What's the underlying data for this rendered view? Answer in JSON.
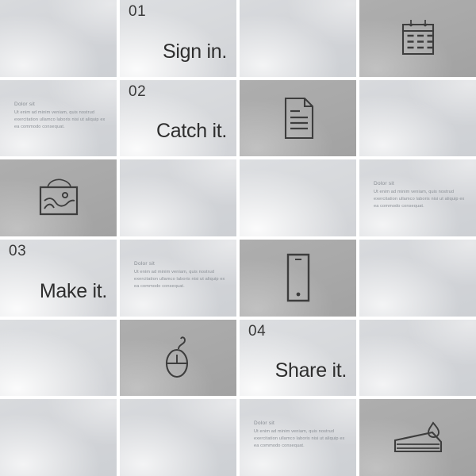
{
  "theme": {
    "tile_light": "#d5d7da",
    "tile_dark": "#a8a8a8",
    "gap": "#ffffff",
    "heading_color": "#2e2e2e",
    "body_text_color": "#8b9096",
    "icon_stroke": "#3d3d3d"
  },
  "copy": {
    "title": "Dolor sit",
    "body": "Ut enim ad minim veniam, quis nostrud exercitation ullamco laboris nisi ut aliquip ex ea commodo consequat."
  },
  "steps": [
    {
      "number": "01",
      "headline": "Sign in."
    },
    {
      "number": "02",
      "headline": "Catch it."
    },
    {
      "number": "03",
      "headline": "Make it."
    },
    {
      "number": "04",
      "headline": "Share it."
    }
  ],
  "icons": [
    {
      "name": "calendar-icon"
    },
    {
      "name": "document-icon"
    },
    {
      "name": "picture-frame-icon"
    },
    {
      "name": "mobile-phone-icon"
    },
    {
      "name": "computer-mouse-icon"
    },
    {
      "name": "cake-slice-icon"
    }
  ],
  "tiles": [
    {
      "id": "r1c1",
      "shade": "light",
      "content": "empty"
    },
    {
      "id": "r1c2",
      "shade": "lighter",
      "content": "step",
      "step": 0
    },
    {
      "id": "r1c3",
      "shade": "light",
      "content": "empty"
    },
    {
      "id": "r1c4",
      "shade": "dark",
      "content": "icon",
      "icon": 0
    },
    {
      "id": "r2c1",
      "shade": "light",
      "content": "copy"
    },
    {
      "id": "r2c2",
      "shade": "lighter",
      "content": "step",
      "step": 1
    },
    {
      "id": "r2c3",
      "shade": "dark",
      "content": "icon",
      "icon": 1
    },
    {
      "id": "r2c4",
      "shade": "light",
      "content": "empty"
    },
    {
      "id": "r3c1",
      "shade": "dark",
      "content": "icon",
      "icon": 2
    },
    {
      "id": "r3c2",
      "shade": "light",
      "content": "empty"
    },
    {
      "id": "r3c3",
      "shade": "lighter",
      "content": "empty"
    },
    {
      "id": "r3c4",
      "shade": "light",
      "content": "copy"
    },
    {
      "id": "r4c1",
      "shade": "lighter",
      "content": "step",
      "step": 2
    },
    {
      "id": "r4c2",
      "shade": "light",
      "content": "copy"
    },
    {
      "id": "r4c3",
      "shade": "dark",
      "content": "icon",
      "icon": 3
    },
    {
      "id": "r4c4",
      "shade": "light",
      "content": "empty"
    },
    {
      "id": "r5c1",
      "shade": "lighter",
      "content": "empty"
    },
    {
      "id": "r5c2",
      "shade": "dark",
      "content": "icon",
      "icon": 4
    },
    {
      "id": "r5c3",
      "shade": "lighter",
      "content": "step",
      "step": 3
    },
    {
      "id": "r5c4",
      "shade": "light",
      "content": "empty"
    },
    {
      "id": "r6c1",
      "shade": "light",
      "content": "empty"
    },
    {
      "id": "r6c2",
      "shade": "light",
      "content": "empty"
    },
    {
      "id": "r6c3",
      "shade": "light",
      "content": "copy"
    },
    {
      "id": "r6c4",
      "shade": "dark",
      "content": "icon",
      "icon": 5
    }
  ]
}
